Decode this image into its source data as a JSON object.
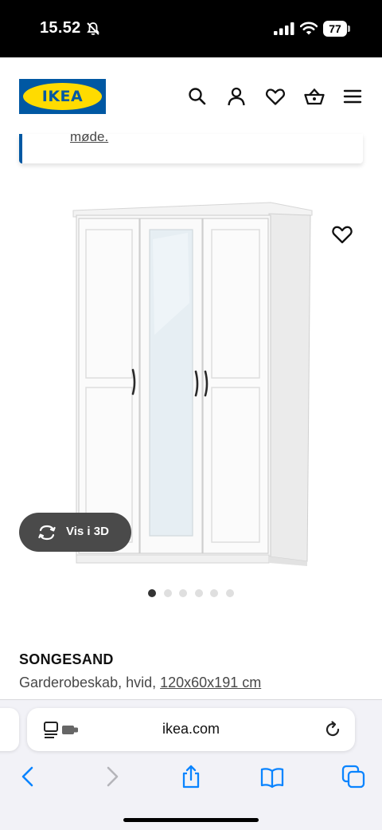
{
  "status_bar": {
    "time": "15.52",
    "battery": "77",
    "icons": [
      "bell-off-icon",
      "signal-icon",
      "wifi-icon",
      "battery-icon"
    ]
  },
  "header": {
    "logo_text": "IKEA",
    "icons": [
      "search-icon",
      "account-icon",
      "favorites-icon",
      "basket-icon",
      "menu-icon"
    ]
  },
  "notice": {
    "link_text": "møde."
  },
  "gallery": {
    "view3d_label": "Vis i 3D",
    "slide_count": 6,
    "active_slide": 1
  },
  "product": {
    "name": "SONGESAND",
    "description": "Garderobeskab, hvid,",
    "dimensions": "120x60x191 cm"
  },
  "browser": {
    "url": "ikea.com",
    "toolbar": [
      "back-icon",
      "forward-icon",
      "share-icon",
      "bookmarks-icon",
      "tabs-icon"
    ]
  },
  "colors": {
    "ikea_blue": "#0058a3",
    "ikea_yellow": "#ffdb00",
    "ios_blue": "#0a84ff"
  }
}
